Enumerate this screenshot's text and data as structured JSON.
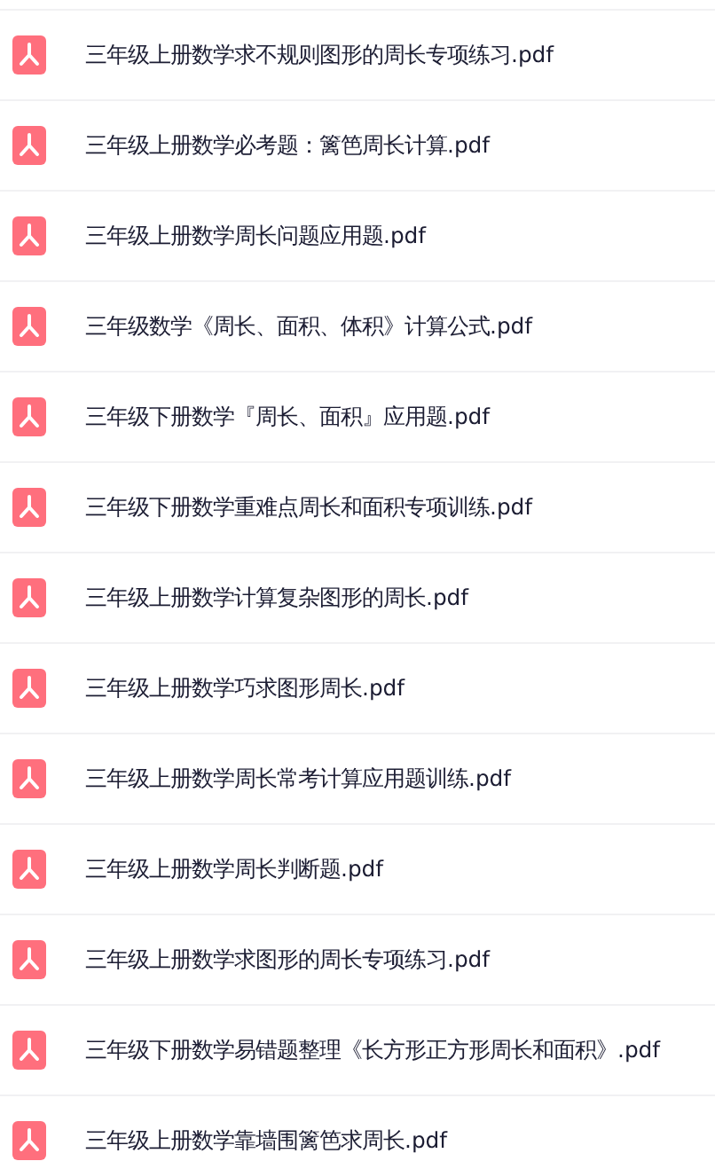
{
  "files": [
    {
      "name": "三年级上册数学求不规则图形的周长专项练习.pdf"
    },
    {
      "name": "三年级上册数学必考题：篱笆周长计算.pdf"
    },
    {
      "name": "三年级上册数学周长问题应用题.pdf"
    },
    {
      "name": "三年级数学《周长、面积、体积》计算公式.pdf"
    },
    {
      "name": "三年级下册数学『周长、面积』应用题.pdf"
    },
    {
      "name": "三年级下册数学重难点周长和面积专项训练.pdf"
    },
    {
      "name": "三年级上册数学计算复杂图形的周长.pdf"
    },
    {
      "name": "三年级上册数学巧求图形周长.pdf"
    },
    {
      "name": "三年级上册数学周长常考计算应用题训练.pdf"
    },
    {
      "name": "三年级上册数学周长判断题.pdf"
    },
    {
      "name": "三年级上册数学求图形的周长专项练习.pdf"
    },
    {
      "name": "三年级下册数学易错题整理《长方形正方形周长和面积》.pdf"
    },
    {
      "name": "三年级上册数学靠墙围篱笆求周长.pdf"
    }
  ]
}
